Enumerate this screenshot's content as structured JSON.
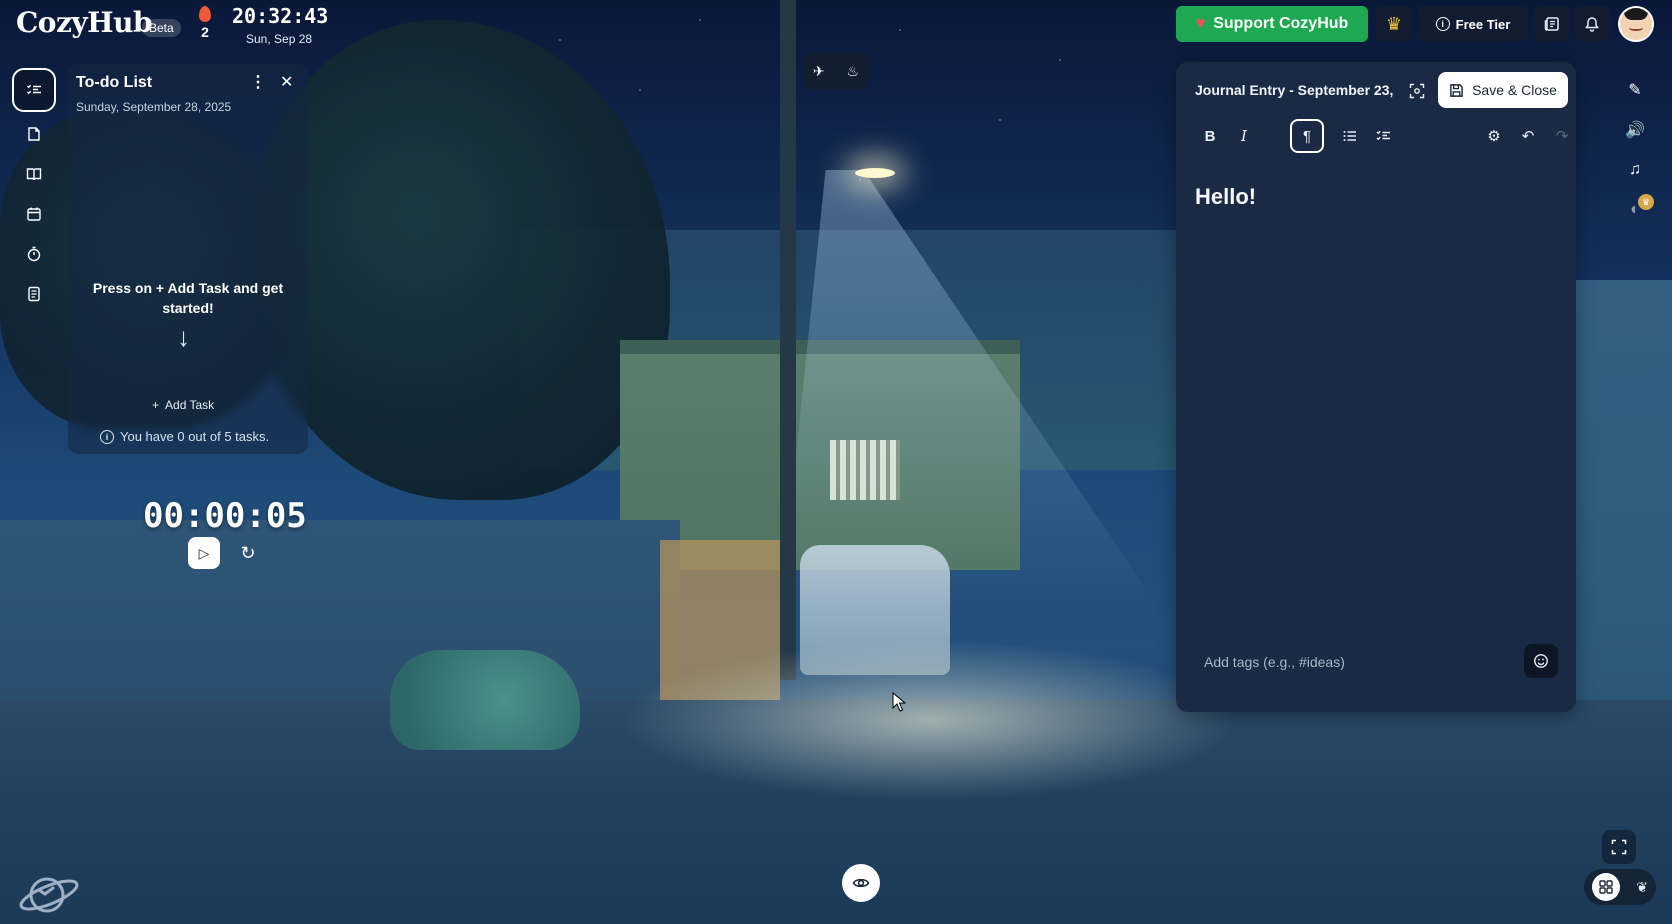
{
  "brand": {
    "name": "CozyHub",
    "badge": "Beta"
  },
  "streak": {
    "count": "2",
    "icon": "flame-icon"
  },
  "clock": {
    "time": "20:32:43",
    "date": "Sun, Sep 28"
  },
  "topbar": {
    "support_label": "Support CozyHub",
    "tier_label": "Free Tier",
    "icons": [
      "crown-icon",
      "info-icon",
      "news-icon",
      "bell-icon",
      "avatar"
    ]
  },
  "left_rail": {
    "items": [
      {
        "name": "todo-list",
        "icon": "list-check-icon",
        "active": true
      },
      {
        "name": "notes",
        "icon": "sticky-note-icon",
        "active": false
      },
      {
        "name": "journal",
        "icon": "book-icon",
        "active": false
      },
      {
        "name": "calendar",
        "icon": "calendar-icon",
        "active": false
      },
      {
        "name": "timer",
        "icon": "stopwatch-icon",
        "active": false
      },
      {
        "name": "notepad",
        "icon": "notepad-icon",
        "active": false
      }
    ]
  },
  "todo": {
    "title": "To-do List",
    "date": "Sunday, September 28, 2025",
    "empty_message": "Press on + Add Task and get started!",
    "add_task_label": "Add Task",
    "task_count_text": "You have 0 out of 5 tasks."
  },
  "timer": {
    "display": "00:00:05"
  },
  "journal": {
    "title": "Journal Entry - September 23,",
    "save_label": "Save & Close",
    "body_text": "Hello!",
    "tags_placeholder": "Add tags (e.g., #ideas)",
    "toolbar": [
      "bold",
      "italic",
      "paragraph",
      "bullet-list",
      "checklist",
      "settings",
      "undo",
      "redo"
    ]
  },
  "right_rail": {
    "items": [
      "magic-wand-icon",
      "speaker-icon",
      "music-note-icon",
      "palette-icon"
    ]
  },
  "colors": {
    "support_green": "#1fa852",
    "panel_bg": "#1b2a44",
    "crown_gold": "#f5c542"
  }
}
